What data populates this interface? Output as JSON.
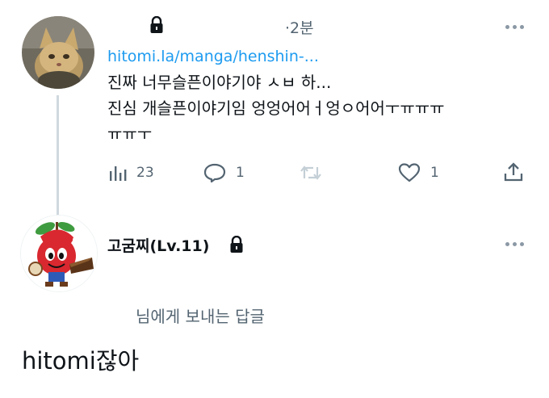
{
  "tweet": {
    "author_name": "",
    "time": "·2분",
    "link": "hitomi.la/manga/henshin-...",
    "lines": [
      "진짜 너무슬픈이야기야 ㅅㅂ 하...",
      "진심 개슬픈이야기임 엉엉어어ㅓ엉ㅇ어어ㅜㅠㅠㅠ",
      "ㅠㅠㅜ"
    ],
    "views": "23",
    "replies": "1",
    "retweets": "",
    "likes": "1"
  },
  "reply": {
    "author_name": "고굼찌(Lv.11)",
    "replying_to": "님에게 보내는 답글",
    "compose_text": "hitomi잖아"
  },
  "icons": [
    "lock-icon",
    "more-icon",
    "views-icon",
    "reply-icon",
    "retweet-icon",
    "like-icon",
    "share-icon"
  ],
  "colors": {
    "link": "#1d9bf0",
    "muted": "#536471",
    "thread_line": "#cfd9de"
  }
}
